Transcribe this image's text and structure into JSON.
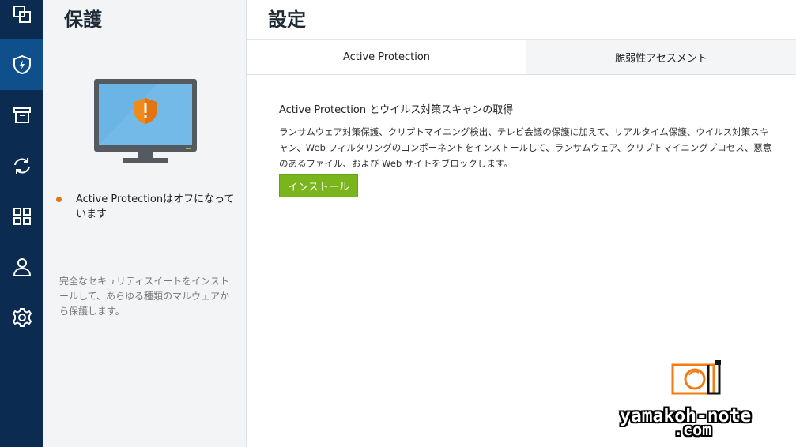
{
  "nav": {
    "items": [
      {
        "icon": "copy-icon",
        "active": false
      },
      {
        "icon": "shield-icon",
        "active": true
      },
      {
        "icon": "archive-icon",
        "active": false
      },
      {
        "icon": "sync-icon",
        "active": false
      },
      {
        "icon": "apps-grid-icon",
        "active": false
      },
      {
        "icon": "account-icon",
        "active": false
      },
      {
        "icon": "gear-icon",
        "active": false
      }
    ]
  },
  "protection": {
    "title": "保護",
    "status_text": "Active Protectionはオフになっています",
    "status_color": "#e2741a",
    "description": "完全なセキュリティスイートをインストールして、あらゆる種類のマルウェアから保護します。"
  },
  "settings": {
    "title": "設定",
    "tabs": [
      {
        "label": "Active Protection",
        "active": true
      },
      {
        "label": "脆弱性アセスメント",
        "active": false
      }
    ],
    "heading": "Active Protection とウイルス対策スキャンの取得",
    "body": "ランサムウェア対策保護、クリプトマイニング検出、テレビ会議の保護に加えて、リアルタイム保護、ウイルス対策スキャン、Web フィルタリングのコンポーネントをインストールして、ランサムウェア、クリプトマイニングプロセス、悪意のあるファイル、および Web サイトをブロックします。",
    "install_label": "インストール",
    "accent": "#7ab51d"
  },
  "watermark": {
    "line1": "yamakoh-note",
    "line2": ".com"
  }
}
